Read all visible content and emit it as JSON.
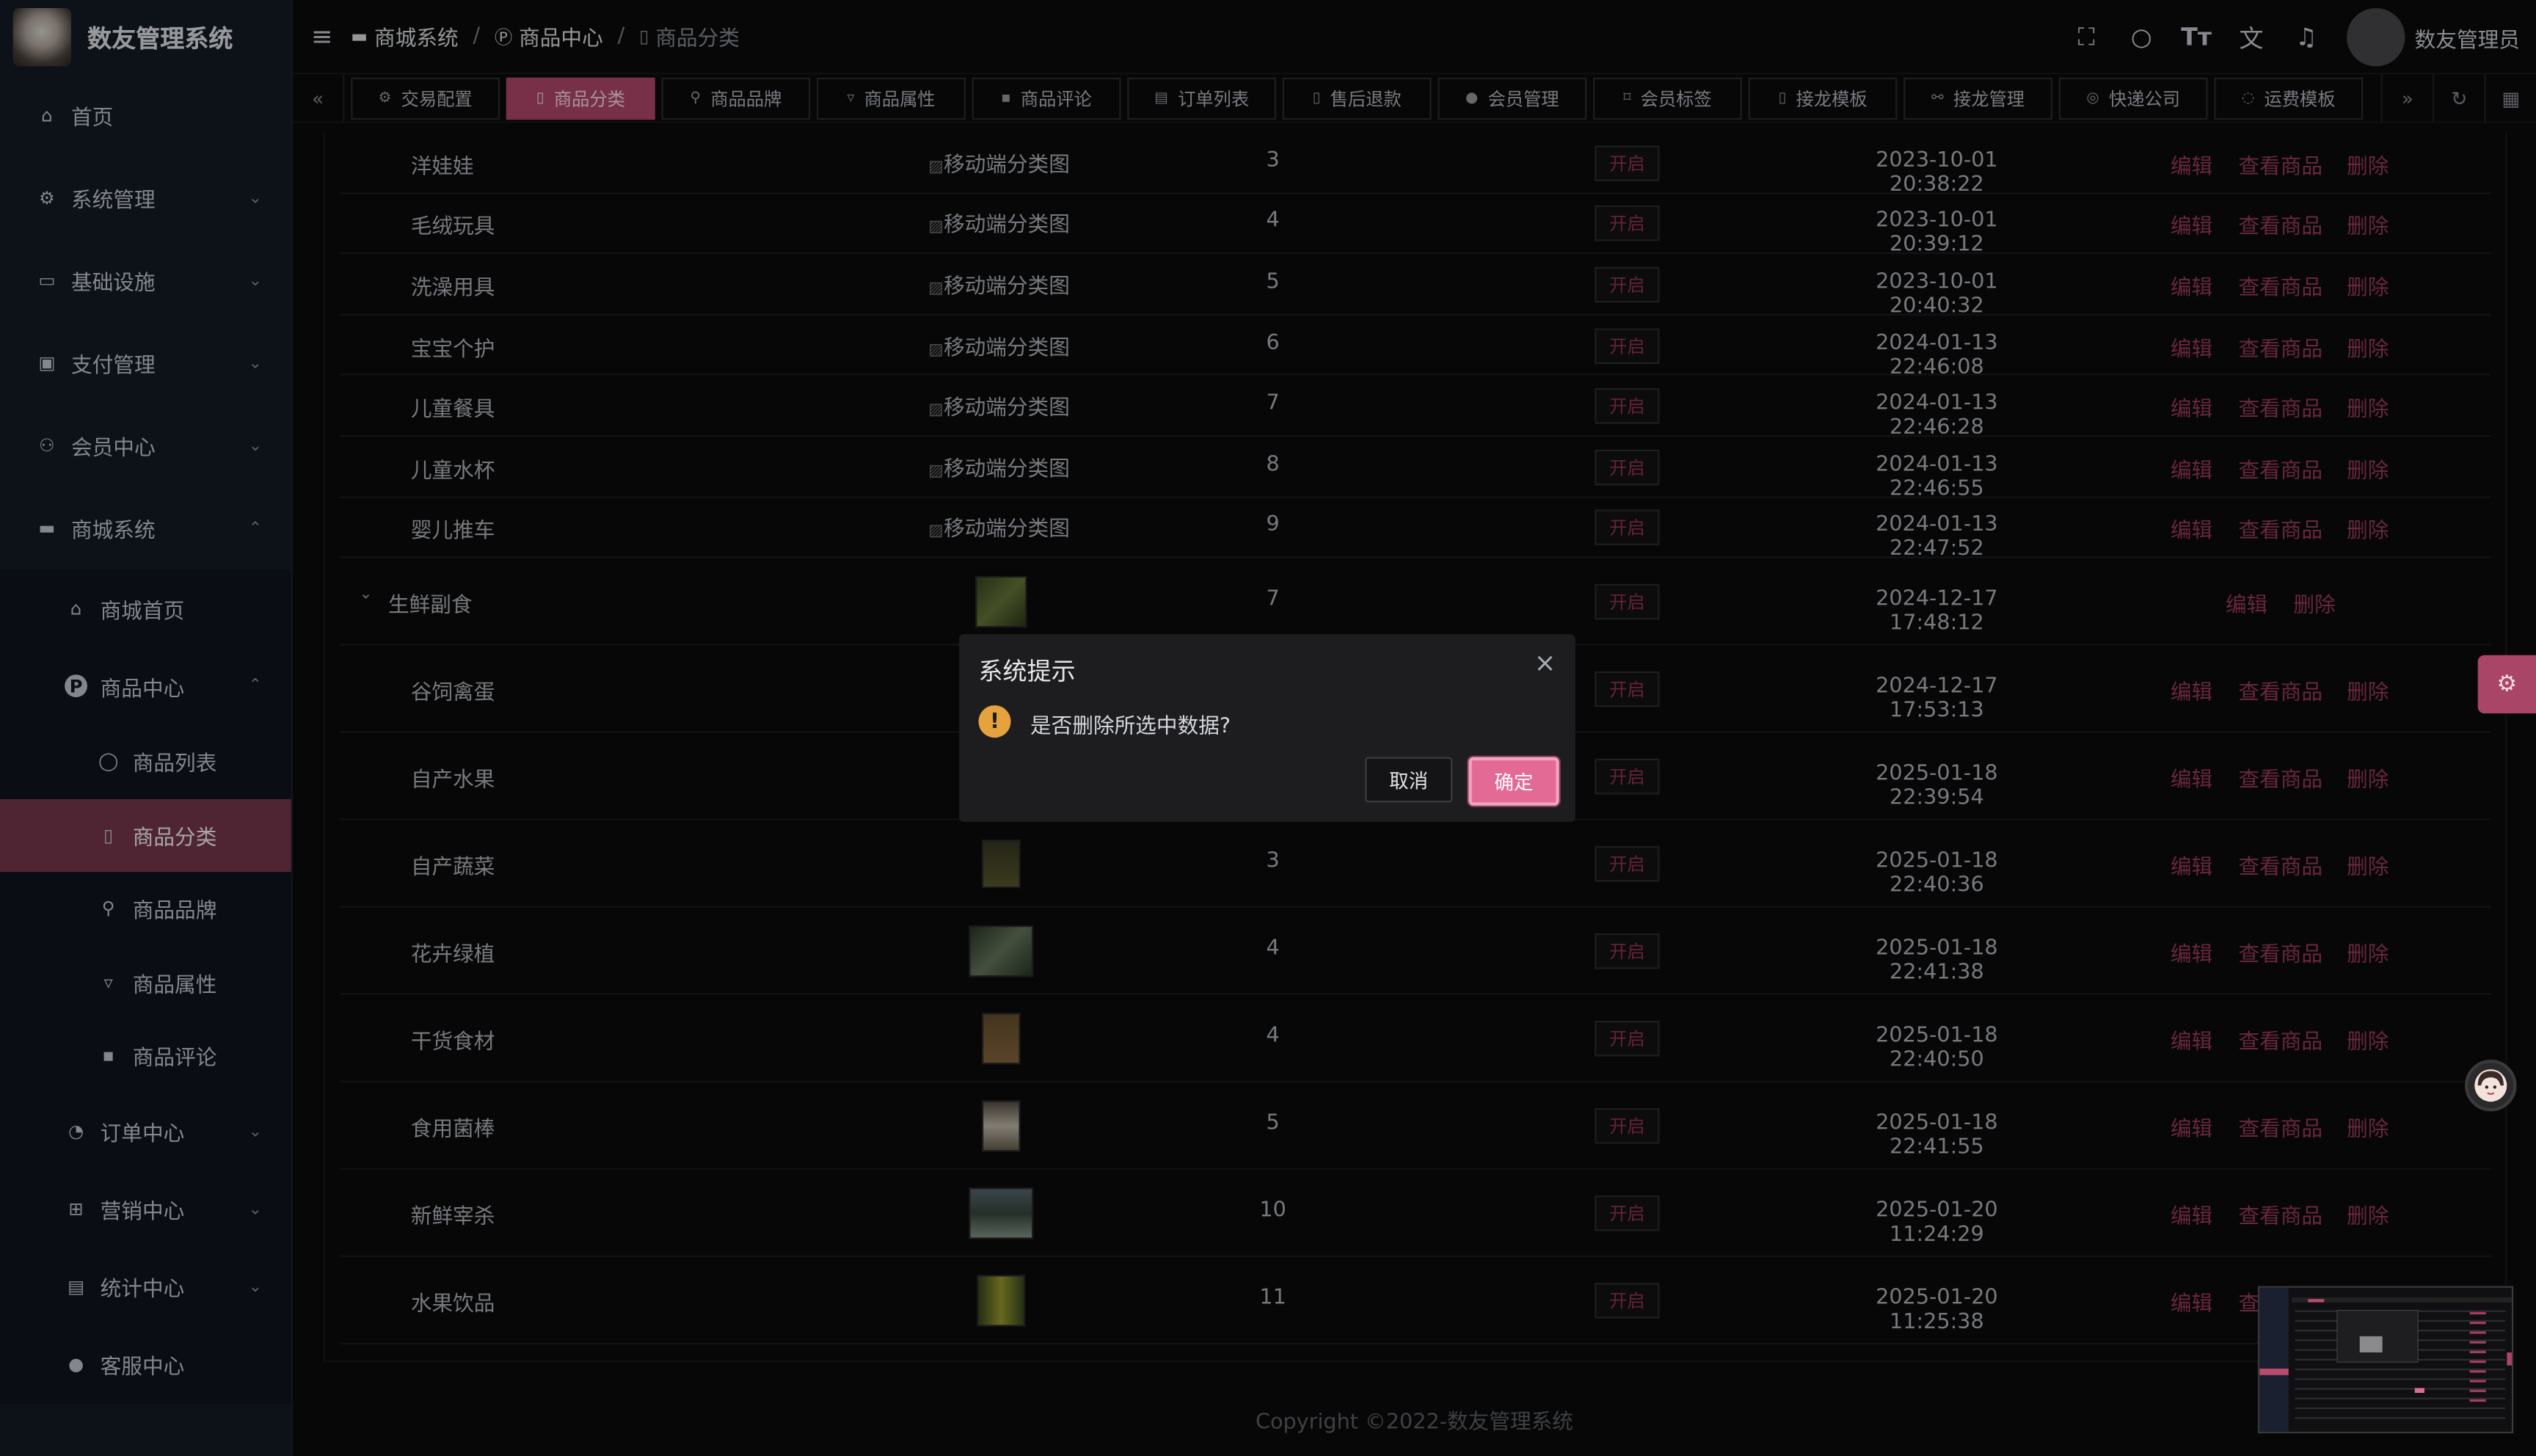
{
  "app": {
    "title": "数友管理系统"
  },
  "menu": {
    "home": "首页",
    "system": "系统管理",
    "infra": "基础设施",
    "pay": "支付管理",
    "member": "会员中心",
    "mall": "商城系统",
    "mall_home": "商城首页",
    "goods_center": "商品中心",
    "goods_list": "商品列表",
    "goods_category": "商品分类",
    "goods_brand": "商品品牌",
    "goods_attr": "商品属性",
    "goods_comment": "商品评论",
    "order_center": "订单中心",
    "marketing": "营销中心",
    "stats": "统计中心",
    "service": "客服中心"
  },
  "breadcrumb": {
    "a": "商城系统",
    "b": "商品中心",
    "c": "商品分类"
  },
  "user": {
    "name": "数友管理员"
  },
  "tabs": [
    "交易配置",
    "商品分类",
    "商品品牌",
    "商品属性",
    "商品评论",
    "订单列表",
    "售后退款",
    "会员管理",
    "会员标签",
    "接龙模板",
    "接龙管理",
    "快递公司",
    "运费模板"
  ],
  "table": {
    "img_alt": "移动端分类图",
    "status": "开启",
    "actions": {
      "edit": "编辑",
      "view": "查看商品",
      "del": "删除"
    },
    "rows": [
      {
        "name": "洋娃娃",
        "sort": "3",
        "time": "2023-10-01 20:38:22"
      },
      {
        "name": "毛绒玩具",
        "sort": "4",
        "time": "2023-10-01 20:39:12"
      },
      {
        "name": "洗澡用具",
        "sort": "5",
        "time": "2023-10-01 20:40:32"
      },
      {
        "name": "宝宝个护",
        "sort": "6",
        "time": "2024-01-13 22:46:08"
      },
      {
        "name": "儿童餐具",
        "sort": "7",
        "time": "2024-01-13 22:46:28"
      },
      {
        "name": "儿童水杯",
        "sort": "8",
        "time": "2024-01-13 22:46:55"
      },
      {
        "name": "婴儿推车",
        "sort": "9",
        "time": "2024-01-13 22:47:52"
      }
    ],
    "parent": {
      "name": "生鲜副食",
      "sort": "7",
      "time": "2024-12-17 17:48:12"
    },
    "rows2": [
      {
        "name": "谷饲禽蛋",
        "sort": "",
        "time": "2024-12-17 17:53:13"
      },
      {
        "name": "自产水果",
        "sort": "",
        "time": "2025-01-18 22:39:54"
      },
      {
        "name": "自产蔬菜",
        "sort": "3",
        "time": "2025-01-18 22:40:36"
      },
      {
        "name": "花卉绿植",
        "sort": "4",
        "time": "2025-01-18 22:41:38"
      },
      {
        "name": "干货食材",
        "sort": "4",
        "time": "2025-01-18 22:40:50"
      },
      {
        "name": "食用菌棒",
        "sort": "5",
        "time": "2025-01-18 22:41:55"
      },
      {
        "name": "新鲜宰杀",
        "sort": "10",
        "time": "2025-01-20 11:24:29"
      },
      {
        "name": "水果饮品",
        "sort": "11",
        "time": "2025-01-20 11:25:38"
      }
    ]
  },
  "dialog": {
    "title": "系统提示",
    "message": "是否删除所选中数据?",
    "cancel": "取消",
    "ok": "确定"
  },
  "footer": "Copyright ©2022-数友管理系统",
  "colors": {
    "accent": "#b94b6f",
    "warn": "#e6a23c"
  }
}
